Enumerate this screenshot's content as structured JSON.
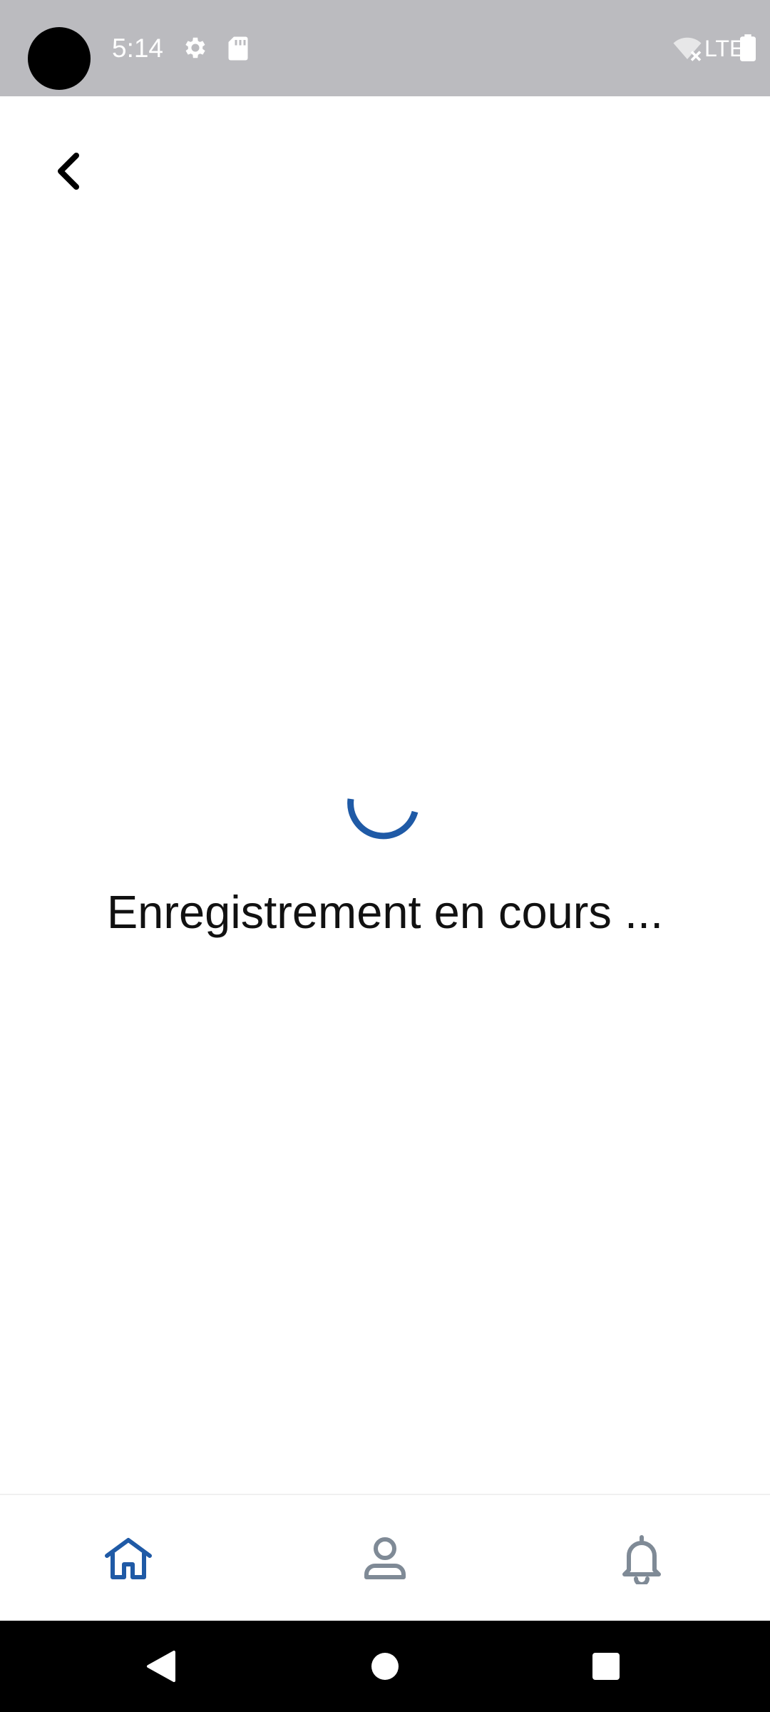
{
  "status_bar": {
    "time": "5:14",
    "network": "LTE",
    "icons": [
      "gear-icon",
      "sd-card-icon",
      "wifi-off-icon",
      "battery-icon"
    ]
  },
  "header": {
    "back_icon": "chevron-left-icon"
  },
  "main": {
    "loading_text": "Enregistrement en cours ...",
    "spinner_color": "#1f5aa6"
  },
  "bottom_nav": {
    "items": [
      {
        "icon": "home-icon",
        "active": true
      },
      {
        "icon": "profile-icon",
        "active": false
      },
      {
        "icon": "bell-icon",
        "active": false
      }
    ],
    "active_color": "#1f5aa6",
    "inactive_color": "#7f8a96"
  },
  "system_nav": {
    "buttons": [
      "back-triangle-icon",
      "home-circle-icon",
      "recents-square-icon"
    ]
  }
}
